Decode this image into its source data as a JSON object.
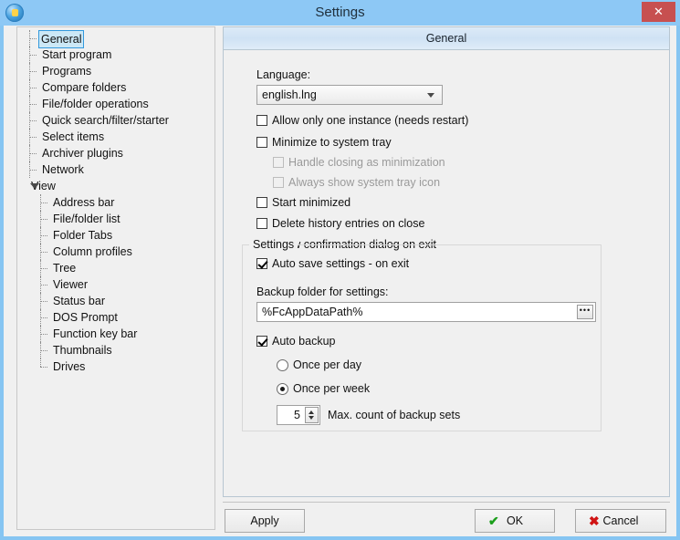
{
  "window": {
    "title": "Settings",
    "app_icon": "app-globe-icon",
    "close_label": "✕",
    "accent_color": "#86c5f2",
    "close_color": "#c75050"
  },
  "sidebar": {
    "items": [
      {
        "label": "General",
        "level": 0,
        "selected": true,
        "expandable": false
      },
      {
        "label": "Start program",
        "level": 0,
        "selected": false,
        "expandable": false
      },
      {
        "label": "Programs",
        "level": 0,
        "selected": false,
        "expandable": false
      },
      {
        "label": "Compare folders",
        "level": 0,
        "selected": false,
        "expandable": false
      },
      {
        "label": "File/folder operations",
        "level": 0,
        "selected": false,
        "expandable": false
      },
      {
        "label": "Quick search/filter/starter",
        "level": 0,
        "selected": false,
        "expandable": false
      },
      {
        "label": "Select items",
        "level": 0,
        "selected": false,
        "expandable": false
      },
      {
        "label": "Archiver plugins",
        "level": 0,
        "selected": false,
        "expandable": false
      },
      {
        "label": "Network",
        "level": 0,
        "selected": false,
        "expandable": false
      },
      {
        "label": "View",
        "level": 0,
        "selected": false,
        "expandable": true
      },
      {
        "label": "Address bar",
        "level": 1,
        "selected": false,
        "expandable": false
      },
      {
        "label": "File/folder list",
        "level": 1,
        "selected": false,
        "expandable": false
      },
      {
        "label": "Folder Tabs",
        "level": 1,
        "selected": false,
        "expandable": false
      },
      {
        "label": "Column profiles",
        "level": 1,
        "selected": false,
        "expandable": false
      },
      {
        "label": "Tree",
        "level": 1,
        "selected": false,
        "expandable": false
      },
      {
        "label": "Viewer",
        "level": 1,
        "selected": false,
        "expandable": false
      },
      {
        "label": "Status bar",
        "level": 1,
        "selected": false,
        "expandable": false
      },
      {
        "label": "DOS Prompt",
        "level": 1,
        "selected": false,
        "expandable": false
      },
      {
        "label": "Function key bar",
        "level": 1,
        "selected": false,
        "expandable": false
      },
      {
        "label": "Thumbnails",
        "level": 1,
        "selected": false,
        "expandable": false
      },
      {
        "label": "Drives",
        "level": 1,
        "selected": false,
        "expandable": false
      }
    ]
  },
  "content": {
    "header": "General",
    "language_label": "Language:",
    "language_value": "english.lng",
    "checkboxes": [
      {
        "label": "Allow only one instance (needs restart)",
        "checked": false,
        "disabled": false,
        "indent": 0
      },
      {
        "label": "Minimize to system tray",
        "checked": false,
        "disabled": false,
        "indent": 0
      },
      {
        "label": "Handle closing as minimization",
        "checked": false,
        "disabled": true,
        "indent": 1
      },
      {
        "label": "Always show system tray icon",
        "checked": false,
        "disabled": true,
        "indent": 1
      },
      {
        "label": "Start minimized",
        "checked": false,
        "disabled": false,
        "indent": 0
      },
      {
        "label": "Delete history entries on close",
        "checked": false,
        "disabled": false,
        "indent": 0
      },
      {
        "label": "Show confirmation dialog on exit",
        "checked": false,
        "disabled": false,
        "indent": 0
      }
    ],
    "group": {
      "title": "Settings",
      "auto_save_label": "Auto save settings - on exit",
      "auto_save_checked": true,
      "backup_folder_label": "Backup folder for settings:",
      "backup_folder_value": "%FcAppDataPath%",
      "browse_label": "•••",
      "auto_backup_label": "Auto backup",
      "auto_backup_checked": true,
      "radios": [
        {
          "label": "Once per day",
          "selected": false
        },
        {
          "label": "Once per week",
          "selected": true
        }
      ],
      "max_count_value": "5",
      "max_count_label": "Max. count of backup sets"
    }
  },
  "buttons": {
    "apply": "Apply",
    "ok": "OK",
    "cancel": "Cancel",
    "ok_glyph": "✔",
    "cancel_glyph": "✖"
  }
}
